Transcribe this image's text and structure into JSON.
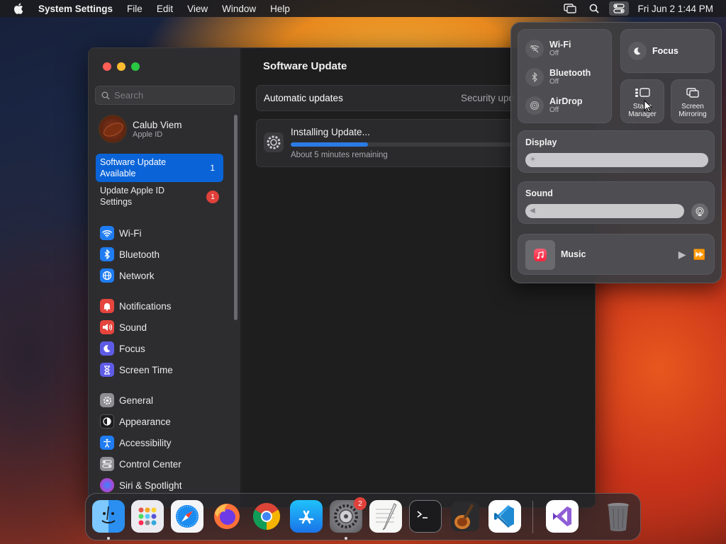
{
  "menubar": {
    "app_name": "System Settings",
    "menus": [
      "File",
      "Edit",
      "View",
      "Window",
      "Help"
    ],
    "clock": "Fri Jun 2  1:44 PM"
  },
  "window": {
    "search_placeholder": "Search",
    "account": {
      "name": "Calub Viem",
      "subtitle": "Apple ID"
    },
    "software_update_row": {
      "label": "Software Update Available",
      "count": "1"
    },
    "apple_id_row": {
      "label": "Update Apple ID Settings",
      "badge": "1"
    },
    "sidebar": {
      "group1": [
        {
          "label": "Wi-Fi",
          "icon": "wifi-icon",
          "color": "#1f7cf2"
        },
        {
          "label": "Bluetooth",
          "icon": "bluetooth-icon",
          "color": "#1f7cf2"
        },
        {
          "label": "Network",
          "icon": "globe-icon",
          "color": "#1f7cf2"
        }
      ],
      "group2": [
        {
          "label": "Notifications",
          "icon": "bell-icon",
          "color": "#e5453d"
        },
        {
          "label": "Sound",
          "icon": "speaker-icon",
          "color": "#e5453d"
        },
        {
          "label": "Focus",
          "icon": "moon-icon",
          "color": "#5e5ce6"
        },
        {
          "label": "Screen Time",
          "icon": "hourglass-icon",
          "color": "#5e5ce6"
        }
      ],
      "group3": [
        {
          "label": "General",
          "icon": "gear-icon",
          "color": "#8e8e93"
        },
        {
          "label": "Appearance",
          "icon": "appearance-icon",
          "color": "#1c1c1e"
        },
        {
          "label": "Accessibility",
          "icon": "accessibility-icon",
          "color": "#1f7cf2"
        },
        {
          "label": "Control Center",
          "icon": "toggles-icon",
          "color": "#8e8e93"
        },
        {
          "label": "Siri & Spotlight",
          "icon": "siri-icon",
          "color": "#a14bd9"
        }
      ]
    },
    "main": {
      "title": "Software Update",
      "automatic_updates_label": "Automatic updates",
      "automatic_updates_value": "Security upd",
      "install_label": "Installing Update...",
      "install_progress_percent": 26,
      "install_remaining": "About 5 minutes remaining"
    }
  },
  "control_center": {
    "wifi": {
      "label": "Wi-Fi",
      "status": "Off"
    },
    "bluetooth": {
      "label": "Bluetooth",
      "status": "Off"
    },
    "airdrop": {
      "label": "AirDrop",
      "status": "Off"
    },
    "focus": {
      "label": "Focus"
    },
    "stage_manager": {
      "label_line1": "Stage",
      "label_line2": "Manager"
    },
    "screen_mirroring": {
      "label_line1": "Screen",
      "label_line2": "Mirroring"
    },
    "display": {
      "label": "Display"
    },
    "sound": {
      "label": "Sound"
    },
    "music": {
      "label": "Music"
    }
  },
  "dock": {
    "apps": [
      "Finder",
      "Launchpad",
      "Safari",
      "Firefox",
      "Chrome",
      "App Store",
      "System Settings",
      "TextEdit",
      "Terminal",
      "GarageBand",
      "Visual Studio Code",
      "Visual Studio",
      "Trash"
    ],
    "system_settings_badge": "2"
  }
}
